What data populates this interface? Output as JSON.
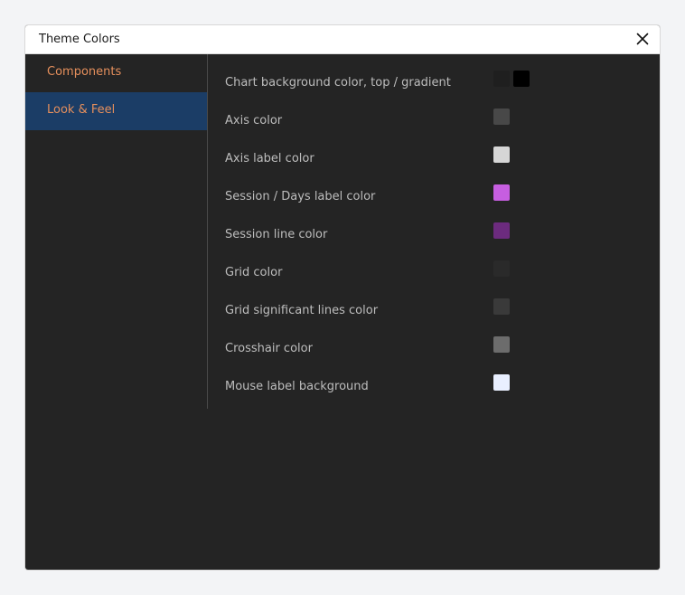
{
  "dialog": {
    "title": "Theme Colors"
  },
  "sidebar": {
    "items": [
      {
        "label": "Components",
        "active": false
      },
      {
        "label": "Look & Feel",
        "active": true
      }
    ]
  },
  "settings": [
    {
      "label": "Chart background color, top / gradient",
      "colors": [
        "#1f1f1f",
        "#000000"
      ]
    },
    {
      "label": "Axis color",
      "colors": [
        "#484848"
      ]
    },
    {
      "label": "Axis label color",
      "colors": [
        "#d6d6d6"
      ]
    },
    {
      "label": "Session / Days label color",
      "colors": [
        "#c65ee0"
      ]
    },
    {
      "label": "Session line color",
      "colors": [
        "#6c2b7e"
      ]
    },
    {
      "label": "Grid color",
      "colors": [
        "#2a2a2a"
      ]
    },
    {
      "label": "Grid significant lines color",
      "colors": [
        "#3a3a3a"
      ]
    },
    {
      "label": "Crosshair color",
      "colors": [
        "#6c6c6c"
      ]
    },
    {
      "label": "Mouse label background",
      "colors": [
        "#e9efff"
      ]
    }
  ],
  "icons": {
    "close": "close-icon"
  }
}
